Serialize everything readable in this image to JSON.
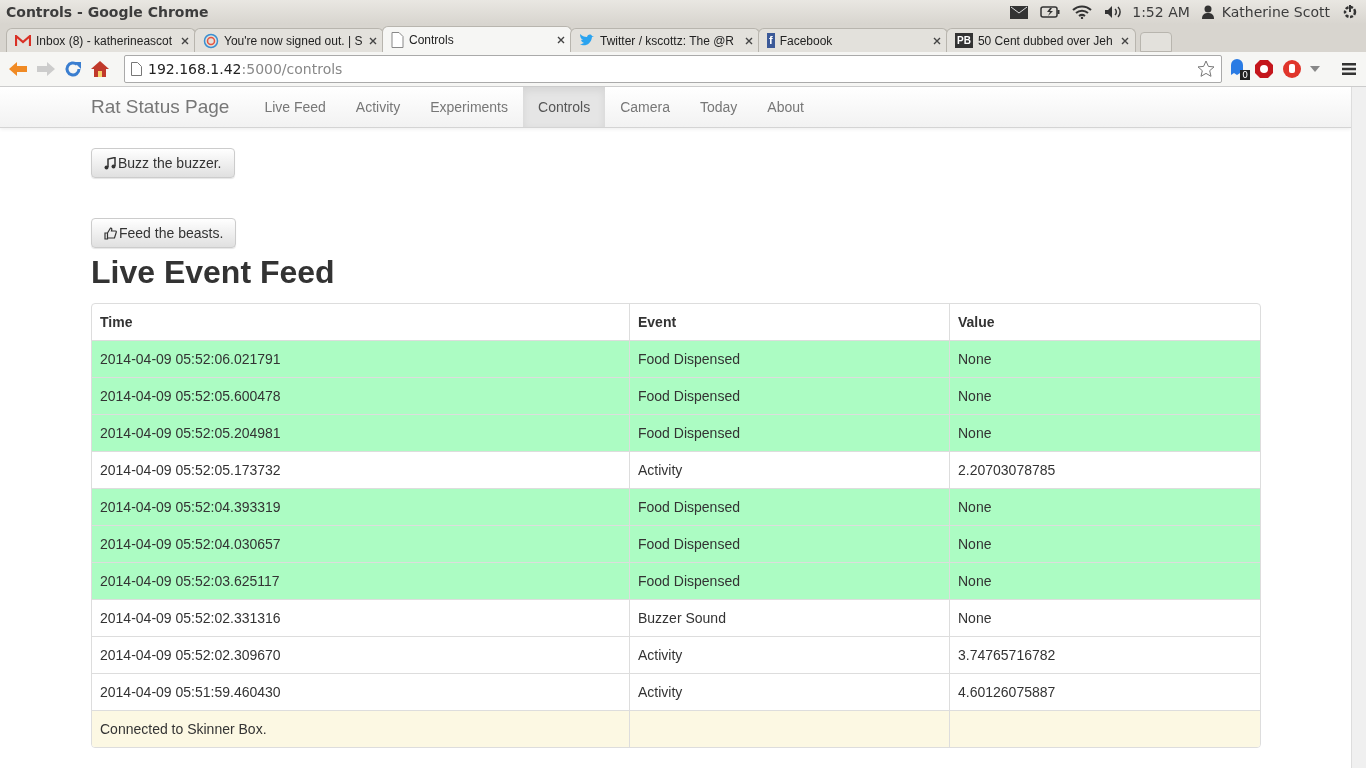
{
  "window": {
    "title": "Controls - Google Chrome"
  },
  "system_tray": {
    "time": "1:52 AM",
    "user": "Katherine Scott"
  },
  "tabs": [
    {
      "label": "Inbox (8) - katherineascot",
      "kind": "mail",
      "selected": false
    },
    {
      "label": "You're now signed out. | S",
      "kind": "globe",
      "selected": false
    },
    {
      "label": "Controls",
      "kind": "page",
      "selected": true
    },
    {
      "label": "Twitter / kscottz: The @R",
      "kind": "bird",
      "selected": false
    },
    {
      "label": "Facebook",
      "kind": "letter",
      "icon_text": "f",
      "selected": false
    },
    {
      "label": "50 Cent dubbed over Jeh",
      "kind": "letter",
      "icon_text": "PB",
      "selected": false
    }
  ],
  "address_bar": {
    "host": "192.168.1.42",
    "rest": ":5000/controls"
  },
  "extension_badge": "0",
  "navbar": {
    "brand": "Rat Status Page",
    "items": [
      {
        "label": "Live Feed",
        "selected": false
      },
      {
        "label": "Activity",
        "selected": false
      },
      {
        "label": "Experiments",
        "selected": false
      },
      {
        "label": "Controls",
        "selected": true
      },
      {
        "label": "Camera",
        "selected": false
      },
      {
        "label": "Today",
        "selected": false
      },
      {
        "label": "About",
        "selected": false
      }
    ]
  },
  "buttons": [
    {
      "label": "Buzz the buzzer.",
      "kind": "music"
    },
    {
      "label": "Feed the beasts.",
      "kind": "thumb"
    }
  ],
  "heading": "Live Event Feed",
  "table": {
    "columns": [
      "Time",
      "Event",
      "Value"
    ],
    "rows": [
      {
        "kind": "success",
        "cells": [
          "2014-04-09 05:52:06.021791",
          "Food Dispensed",
          "None"
        ]
      },
      {
        "kind": "success",
        "cells": [
          "2014-04-09 05:52:05.600478",
          "Food Dispensed",
          "None"
        ]
      },
      {
        "kind": "success",
        "cells": [
          "2014-04-09 05:52:05.204981",
          "Food Dispensed",
          "None"
        ]
      },
      {
        "kind": "plain",
        "cells": [
          "2014-04-09 05:52:05.173732",
          "Activity",
          "2.20703078785"
        ]
      },
      {
        "kind": "success",
        "cells": [
          "2014-04-09 05:52:04.393319",
          "Food Dispensed",
          "None"
        ]
      },
      {
        "kind": "success",
        "cells": [
          "2014-04-09 05:52:04.030657",
          "Food Dispensed",
          "None"
        ]
      },
      {
        "kind": "success",
        "cells": [
          "2014-04-09 05:52:03.625117",
          "Food Dispensed",
          "None"
        ]
      },
      {
        "kind": "plain",
        "cells": [
          "2014-04-09 05:52:02.331316",
          "Buzzer Sound",
          "None"
        ]
      },
      {
        "kind": "plain",
        "cells": [
          "2014-04-09 05:52:02.309670",
          "Activity",
          "3.74765716782"
        ]
      },
      {
        "kind": "plain",
        "cells": [
          "2014-04-09 05:51:59.460430",
          "Activity",
          "4.60126075887"
        ]
      },
      {
        "kind": "warning",
        "cells": [
          "Connected to Skinner Box."
        ]
      }
    ]
  }
}
